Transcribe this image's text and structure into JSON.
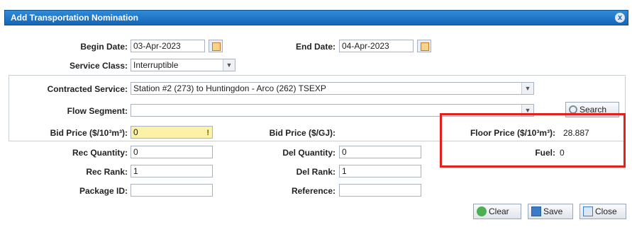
{
  "dialog": {
    "title": "Add Transportation Nomination",
    "close_icon": "x"
  },
  "form": {
    "begin_date": {
      "label": "Begin Date:",
      "value": "03-Apr-2023"
    },
    "end_date": {
      "label": "End Date:",
      "value": "04-Apr-2023"
    },
    "service_class": {
      "label": "Service Class:",
      "value": "Interruptible"
    },
    "contracted_service": {
      "label": "Contracted Service:",
      "value": "Station #2 (273) to Huntingdon - Arco (262) TSEXP"
    },
    "flow_segment": {
      "label": "Flow Segment:",
      "value": ""
    },
    "search_button": "Search",
    "bid_price_m3": {
      "label": "Bid Price ($/10³m³):",
      "value": "0",
      "warning": "!"
    },
    "bid_price_gj": {
      "label": "Bid Price ($/GJ):"
    },
    "floor_price": {
      "label": "Floor Price ($/10³m³):",
      "value": "28.887"
    },
    "fuel": {
      "label": "Fuel:",
      "value": "0"
    },
    "rec_quantity": {
      "label": "Rec Quantity:",
      "value": "0"
    },
    "del_quantity": {
      "label": "Del Quantity:",
      "value": "0"
    },
    "rec_rank": {
      "label": "Rec Rank:",
      "value": "1"
    },
    "del_rank": {
      "label": "Del Rank:",
      "value": "1"
    },
    "package_id": {
      "label": "Package ID:",
      "value": ""
    },
    "reference": {
      "label": "Reference:",
      "value": ""
    }
  },
  "buttons": {
    "clear": "Clear",
    "save": "Save",
    "close": "Close"
  },
  "colors": {
    "titlebar": "#1565b8",
    "highlight_box": "#e3201b",
    "warning_field": "#fbf2a8"
  }
}
